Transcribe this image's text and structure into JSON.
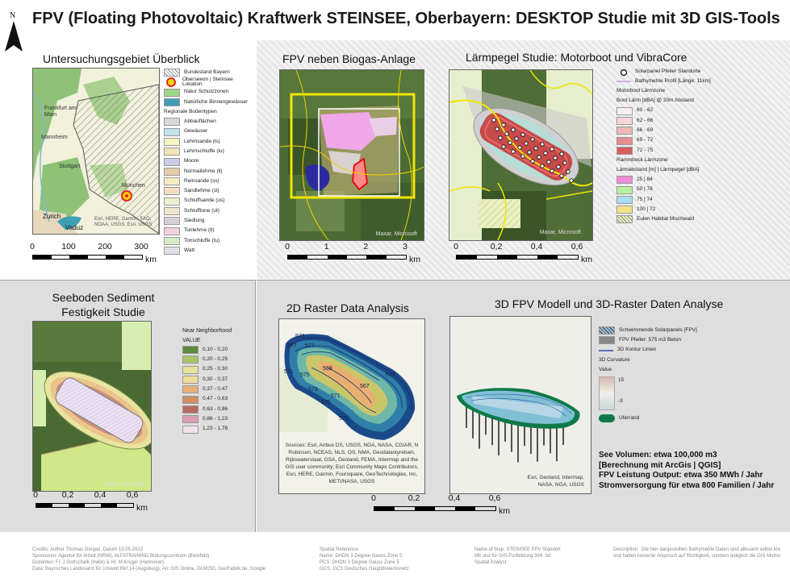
{
  "title": "FPV (Floating Photovoltaic) Kraftwerk STEINSEE, Oberbayern: DESKTOP Studie mit 3D GIS-Tools",
  "north_label": "N",
  "panel1": {
    "title": "Untersuchungsgebiet Überblick",
    "map_labels": [
      "Frankfurt am Main",
      "Mannheim",
      "Stuttgart",
      "München",
      "Zurich",
      "Vaduz"
    ],
    "attribution": "Esri, HERE, Garmin, FAO, NOAA, USGS, Esri, USGS",
    "legend": [
      {
        "label": "Bundesland Bayern",
        "color": "#ffffff",
        "style": "hatch"
      },
      {
        "label": "Oberseeon | Steinsee Lokation",
        "color": "#e8232a",
        "style": "marker"
      },
      {
        "label": "Natur Schutzzonen",
        "color": "#9fd38a",
        "style": "box"
      },
      {
        "label": "Natürliche Binnengewässer",
        "color": "#3f9fb4",
        "style": "box"
      },
      {
        "label": "Regionale Bodentypen",
        "color": "",
        "style": "header"
      },
      {
        "label": "Abbauflächen",
        "color": "#d9d7dc",
        "style": "box"
      },
      {
        "label": "Gewässer",
        "color": "#bfe3ef",
        "style": "box"
      },
      {
        "label": "Lehmsande (ls)",
        "color": "#f6f3c5",
        "style": "box"
      },
      {
        "label": "Lehmschluffe (lu)",
        "color": "#f3e4b6",
        "style": "box"
      },
      {
        "label": "Moore",
        "color": "#c8cce6",
        "style": "box"
      },
      {
        "label": "Normallehme (ll)",
        "color": "#e7cda6",
        "style": "box"
      },
      {
        "label": "Reinsande (ss)",
        "color": "#f7ecc3",
        "style": "box"
      },
      {
        "label": "Sandlehme (sl)",
        "color": "#f4dfc2",
        "style": "box"
      },
      {
        "label": "Schluffsande (us)",
        "color": "#ecf2cf",
        "style": "box"
      },
      {
        "label": "Schlufftone (ut)",
        "color": "#eee5cd",
        "style": "box"
      },
      {
        "label": "Siedlung",
        "color": "#d8d0d8",
        "style": "box"
      },
      {
        "label": "Tonlehme (tl)",
        "color": "#efd2dc",
        "style": "box"
      },
      {
        "label": "Tonschluffe (tu)",
        "color": "#d6ecc8",
        "style": "box"
      },
      {
        "label": "Watt",
        "color": "#e2ddeb",
        "style": "box"
      }
    ],
    "scale": {
      "ticks": [
        "0",
        "100",
        "200",
        "300"
      ],
      "unit": "km"
    }
  },
  "panel2": {
    "title": "FPV neben Biogas-Anlage",
    "attribution": "Maxar, Microsoft",
    "scale": {
      "ticks": [
        "0",
        "1",
        "2",
        "3"
      ],
      "unit": "km"
    }
  },
  "panel3": {
    "title": "Lärmpegel Studie: Motorboot  und VibraCore",
    "attribution": "Maxar, Microsoft",
    "legend": [
      {
        "label": "Solarpanel Pfeiler Standorte",
        "color": "#ffffff",
        "style": "dot"
      },
      {
        "label": "Bathymetrie Profil [Länge: 11km]",
        "color": "#c79ad6",
        "style": "line"
      },
      {
        "label": "Motorboot Lärmzone",
        "color": "",
        "style": "header"
      },
      {
        "label": "Boot Lärm [dBA] @ 20m Abstand",
        "color": "",
        "style": "header"
      },
      {
        "label": "60 - 62",
        "color": "#fbeeee",
        "style": "box"
      },
      {
        "label": "62 - 66",
        "color": "#f6d6d6",
        "style": "box"
      },
      {
        "label": "66 - 69",
        "color": "#efb8b8",
        "style": "box"
      },
      {
        "label": "69 - 72",
        "color": "#e68c8c",
        "style": "box"
      },
      {
        "label": "72 - 75",
        "color": "#d85e5e",
        "style": "box"
      },
      {
        "label": "Rammbock Lärmzone",
        "color": "",
        "style": "header"
      },
      {
        "label": "Lärmabstand [m] | Lärmpegel [dBA]",
        "color": "",
        "style": "header"
      },
      {
        "label": "25 | 84",
        "color": "#f08ad6",
        "style": "box"
      },
      {
        "label": "50 | 78",
        "color": "#b8f0a0",
        "style": "box"
      },
      {
        "label": "75 | 74",
        "color": "#a8dcf0",
        "style": "box"
      },
      {
        "label": "100 | 72",
        "color": "#f4e28a",
        "style": "box"
      },
      {
        "label": "Eulen Habitat Mischwald",
        "color": "#eaf0c0",
        "style": "hatch"
      }
    ],
    "scale": {
      "ticks": [
        "0",
        "0,2",
        "0,4",
        "0,6"
      ],
      "unit": "km"
    }
  },
  "panel4": {
    "title_line1": "Seeboden Sediment",
    "title_line2": "Festigkeit Studie",
    "attribution": "Maxar, Microsoft",
    "legend_header": "Near Neighborhood",
    "legend_subheader": "VALUE",
    "legend": [
      {
        "label": "0,10 - 0,20",
        "color": "#5a8a3c"
      },
      {
        "label": "0,20 - 0,25",
        "color": "#a9c66a"
      },
      {
        "label": "0,25 - 0,30",
        "color": "#e6e49a"
      },
      {
        "label": "0,30 - 0,37",
        "color": "#f2dc9a"
      },
      {
        "label": "0,37 - 0,47",
        "color": "#e6b078"
      },
      {
        "label": "0,47 - 0,63",
        "color": "#d08e62"
      },
      {
        "label": "0,63 - 0,86",
        "color": "#b56c5e"
      },
      {
        "label": "0,86 - 1,23",
        "color": "#d9a0b4"
      },
      {
        "label": "1,23 - 1,78",
        "color": "#f2e0ee"
      }
    ],
    "scale": {
      "ticks": [
        "0",
        "0,2",
        "0,4",
        "0,6"
      ],
      "unit": "km"
    }
  },
  "panel5": {
    "title": "2D Raster Data Analysis",
    "contour_labels": [
      "573",
      "577",
      "577",
      "569",
      "571",
      "575",
      "573",
      "567",
      "571",
      "571",
      "575",
      "577"
    ],
    "sources": "Sources: Esri, Airbus DS, USGS, NGA, NASA, CGIAR, N Robinson, NCEAS, NLS, OS, NMA, Geodatastyrelsen, Rijkswaterstaat, GSA, Geoland, FEMA, Intermap and the GIS user community; Esri Community Maps Contributors, Esri, HERE, Garmin, Foursquare, GeoTechnologies, Inc, METI/NASA, USGS",
    "scale": {
      "ticks": [
        "0",
        "0,2",
        "0,4",
        "0,6"
      ],
      "unit": "km"
    }
  },
  "panel6": {
    "title": "3D FPV Modell und 3D-Raster Daten Analyse",
    "attribution": "Esri, Geoland, Intermap, NASA, NGA, USGS",
    "legend": [
      {
        "label": "Schwimmende Solarpanels [FPV]",
        "color": "#9fc1d8",
        "style": "hatchbox"
      },
      {
        "label": "FPV Pfeiler: 575 m3 Beton",
        "color": "#888888",
        "style": "box"
      },
      {
        "label": "3D Kontur Linien",
        "color": "#3a4fa8",
        "style": "line"
      },
      {
        "label": "3D Curvature",
        "color": "",
        "style": "header"
      },
      {
        "label": "Value",
        "color": "",
        "style": "header"
      }
    ],
    "ramp_high": "15",
    "ramp_low": "-3",
    "uferrand": "Uferrand",
    "notes": [
      "See Volumen: etwa 100,000 m3",
      "[Berechnung mit ArcGis | QGIS]",
      "FPV Leistung Output: etwa 350 MWh / Jahr",
      "Stromversorgung für etwa 800 Familien / Jahr"
    ]
  },
  "footer": {
    "credits": "Credits:  Author Thomas Gorgas, Datum 13.05.2022\nSponsoren: Agentur für Arbeit (NRW), ALFATRAINING Bildungszentrum (Bielefeld)\nDozenten: Fr. J.Gottschalk (Halle) & Hr. M.Krüger (Hannover)\nData: Bayrisches Landesamt für Umwelt Ref.14 (Augsburg), Arc GIS Online, DLM250, GeoFabrik.de, Google",
    "spatial": "Spatial Reference\nName: DHDN 3 Degree Gauss Zone 5\nPCS: DHDN 3 Degree Gauss Zone 5\nGCS: GCS Deutsches Hauptdreiecksnetz",
    "mapname": "Name of Map: STEINSEE FPV Standort\nMit und für GIS-Fortbildung 394: 3d\nSpatial Analyst",
    "description": "Description:  Die hier dargestellten Bathymetrie Daten sind allesamt selbst kre\nund haben keinerlei Anspruch auf Richtigkeit, sondern lediglich die GIS Metho"
  }
}
